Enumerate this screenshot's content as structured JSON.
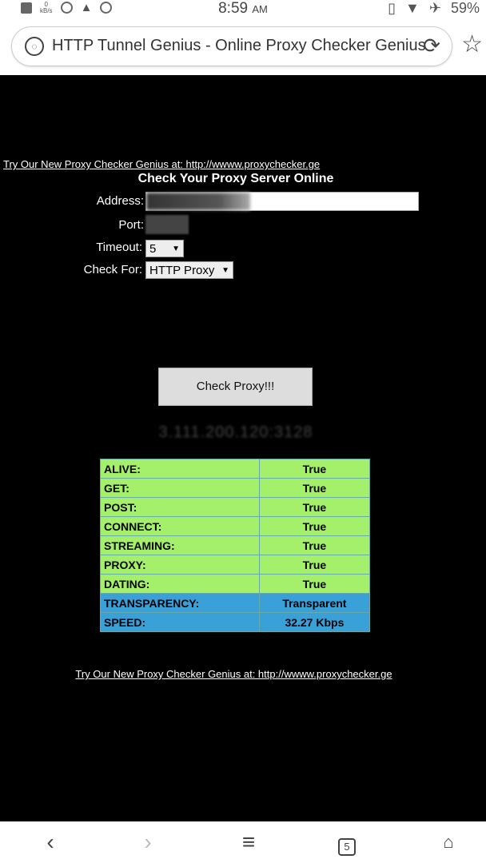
{
  "status": {
    "time": "8:59",
    "ampm": "AM",
    "battery": "59%",
    "net_speed_value": "0",
    "net_speed_unit": "kB/s"
  },
  "browser": {
    "title": "HTTP Tunnel Genius - Online Proxy Checker Genius",
    "tab_count": "5"
  },
  "page": {
    "top_link": "Try Our New Proxy Checker Genius at: http://wwww.proxychecker.ge",
    "form_title": "Check Your Proxy Server Online",
    "address_label": "Address:",
    "port_label": "Port:",
    "timeout_label": "Timeout:",
    "timeout_value": "5",
    "check_for_label": "Check For:",
    "check_for_value": "HTTP Proxy",
    "check_button": "Check Proxy!!!",
    "ip_result": "3.111.200.120:3128",
    "bottom_link": "Try Our New Proxy Checker Genius at: http://wwww.proxychecker.ge"
  },
  "results": [
    {
      "label": "ALIVE:",
      "value": "True"
    },
    {
      "label": "GET:",
      "value": "True"
    },
    {
      "label": "POST:",
      "value": "True"
    },
    {
      "label": "CONNECT:",
      "value": "True"
    },
    {
      "label": "STREAMING:",
      "value": "True"
    },
    {
      "label": "PROXY:",
      "value": "True"
    },
    {
      "label": "DATING:",
      "value": "True"
    },
    {
      "label": "TRANSPARENCY:",
      "value": "Transparent"
    },
    {
      "label": "SPEED:",
      "value": "32.27 Kbps"
    }
  ],
  "colors": {
    "row_ok": "#a4f06a",
    "row_info": "#3aa0d8",
    "page_bg": "#000000"
  },
  "icons": [
    "image-icon",
    "alert-icon",
    "vpn-icon",
    "vibrate-icon",
    "wifi-icon",
    "airplane-icon",
    "site-info-icon",
    "reload-icon",
    "star-icon",
    "back-icon",
    "forward-icon",
    "menu-icon",
    "tabs-icon",
    "home-icon"
  ]
}
